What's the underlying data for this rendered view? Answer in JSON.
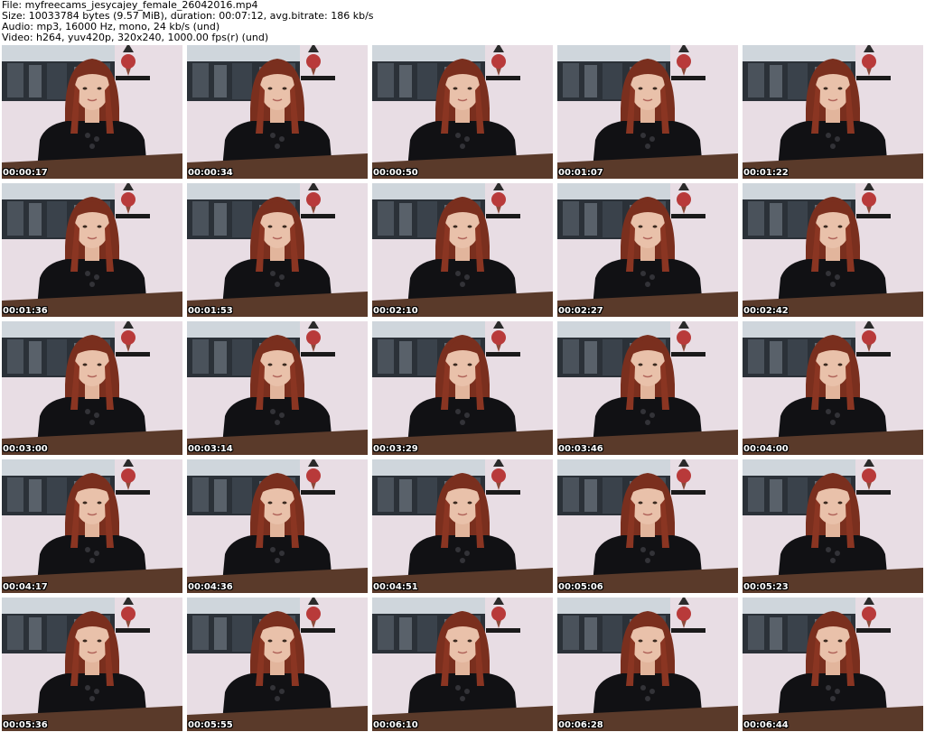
{
  "header": {
    "file": "File: myfreecams_jesycajey_female_26042016.mp4",
    "size": "Size: 10033784 bytes (9.57 MiB), duration: 00:07:12, avg.bitrate: 186 kb/s",
    "audio": "Audio: mp3, 16000 Hz, mono, 24 kb/s (und)",
    "video": "Video: h264, yuv420p, 320x240, 1000.00 fps(r) (und)"
  },
  "thumbnails": [
    {
      "time": "00:00:17"
    },
    {
      "time": "00:00:34"
    },
    {
      "time": "00:00:50"
    },
    {
      "time": "00:01:07"
    },
    {
      "time": "00:01:22"
    },
    {
      "time": "00:01:36"
    },
    {
      "time": "00:01:53"
    },
    {
      "time": "00:02:10"
    },
    {
      "time": "00:02:27"
    },
    {
      "time": "00:02:42"
    },
    {
      "time": "00:03:00"
    },
    {
      "time": "00:03:14"
    },
    {
      "time": "00:03:29"
    },
    {
      "time": "00:03:46"
    },
    {
      "time": "00:04:00"
    },
    {
      "time": "00:04:17"
    },
    {
      "time": "00:04:36"
    },
    {
      "time": "00:04:51"
    },
    {
      "time": "00:05:06"
    },
    {
      "time": "00:05:23"
    },
    {
      "time": "00:05:36"
    },
    {
      "time": "00:05:55"
    },
    {
      "time": "00:06:10"
    },
    {
      "time": "00:06:28"
    },
    {
      "time": "00:06:44"
    }
  ],
  "colors": {
    "wall": "#e9dfe6",
    "poster": "#2b3138",
    "hair": "#7a2f1e",
    "sweater": "#111114",
    "skin": "#e9c1aa",
    "table": "#5a3a2a"
  }
}
